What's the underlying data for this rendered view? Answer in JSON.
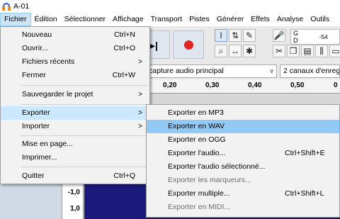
{
  "window": {
    "title": "A-01"
  },
  "menubar": {
    "items": [
      "Fichier",
      "Édition",
      "Sélectionner",
      "Affichage",
      "Transport",
      "Pistes",
      "Générer",
      "Effets",
      "Analyse",
      "Outils"
    ]
  },
  "toolbar": {
    "meter_value": "-54",
    "meter_g": "G",
    "meter_d": "D",
    "capture_device": "capture audio principal",
    "channels": "2 canaux d'enregis"
  },
  "ruler": {
    "ticks": [
      "0,20",
      "0,30",
      "0,40",
      "0,50",
      "0"
    ]
  },
  "track": {
    "scale_labels": [
      "-1,0",
      "1,0"
    ]
  },
  "fichier_menu": {
    "items": [
      {
        "label": "Nouveau",
        "shortcut": "Ctrl+N"
      },
      {
        "label": "Ouvrir...",
        "shortcut": "Ctrl+O"
      },
      {
        "label": "Fichiers récents",
        "shortcut": "",
        "submenu": ">"
      },
      {
        "label": "Fermer",
        "shortcut": "Ctrl+W"
      },
      {
        "label": "Sauvegarder le projet",
        "shortcut": "",
        "submenu": ">"
      },
      {
        "label": "Exporter",
        "shortcut": "",
        "submenu": ">"
      },
      {
        "label": "Importer",
        "shortcut": "",
        "submenu": ">"
      },
      {
        "label": "Mise en page...",
        "shortcut": ""
      },
      {
        "label": "Imprimer...",
        "shortcut": ""
      },
      {
        "label": "Quitter",
        "shortcut": "Ctrl+Q"
      }
    ]
  },
  "export_menu": {
    "items": [
      {
        "label": "Exporter en MP3",
        "shortcut": ""
      },
      {
        "label": "Exporter en WAV",
        "shortcut": ""
      },
      {
        "label": "Exporter en OGG",
        "shortcut": ""
      },
      {
        "label": "Exporter l'audio...",
        "shortcut": "Ctrl+Shift+E"
      },
      {
        "label": "Exporter l'audio sélectionné...",
        "shortcut": ""
      },
      {
        "label": "Exporter les marqueurs...",
        "shortcut": ""
      },
      {
        "label": "Exporter multiple...",
        "shortcut": "Ctrl+Shift+L"
      },
      {
        "label": "Exporter en MIDI...",
        "shortcut": ""
      }
    ]
  }
}
